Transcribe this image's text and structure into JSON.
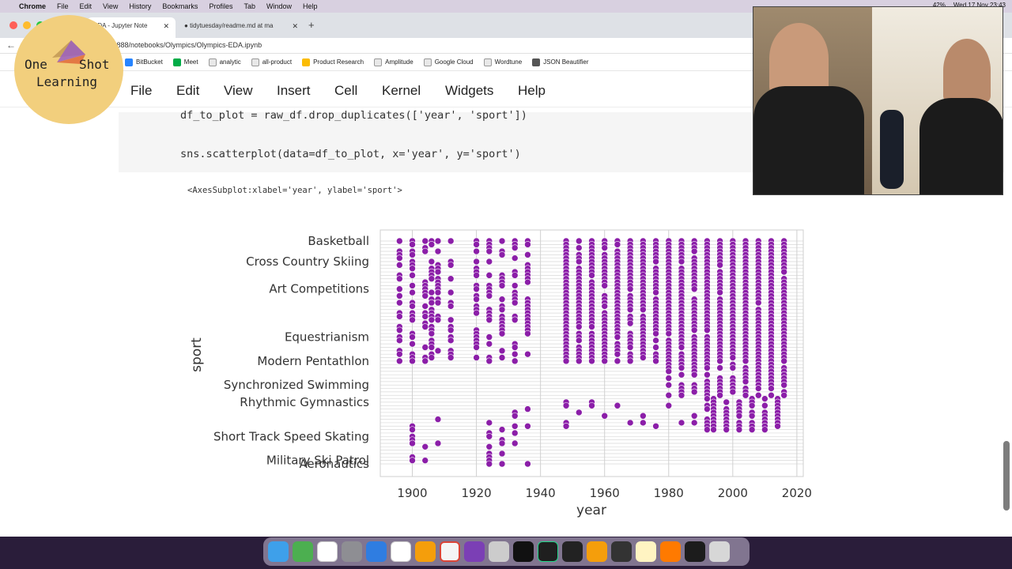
{
  "menubar": {
    "app": "Chrome",
    "items": [
      "File",
      "Edit",
      "View",
      "History",
      "Bookmarks",
      "Profiles",
      "Tab",
      "Window",
      "Help"
    ],
    "battery": "42%",
    "clock": "Wed 17 Nov  23:43"
  },
  "tabs": [
    {
      "label": "EDA - Jupyter Note"
    },
    {
      "label": "tidytuesday/readme.md at ma"
    }
  ],
  "address": {
    "url": "...888/notebooks/Olympics/Olympics-EDA.ipynb"
  },
  "bookmarks": [
    "BitBucket",
    "Meet",
    "analytic",
    "all-product",
    "Product Research",
    "Amplitude",
    "Google Cloud",
    "Wordtune",
    "JSON Beautifier"
  ],
  "jupyter_menu": [
    "File",
    "Edit",
    "View",
    "Insert",
    "Cell",
    "Kernel",
    "Widgets",
    "Help"
  ],
  "logo": {
    "line1a": "One",
    "line1b": "Shot",
    "line2": "Learning"
  },
  "code": {
    "line1": "df_to_plot = raw_df.drop_duplicates(['year', 'sport'])",
    "line2": "sns.scatterplot(data=df_to_plot, x='year', y='sport')"
  },
  "output_text": "<AxesSubplot:xlabel='year', ylabel='sport'>",
  "chart_data": {
    "type": "scatter",
    "title": "",
    "xlabel": "year",
    "ylabel": "sport",
    "xlim": [
      1890,
      2022
    ],
    "xticks": [
      1900,
      1920,
      1940,
      1960,
      1980,
      2000,
      2020
    ],
    "grid": true,
    "color": "#8b1ea8",
    "visible_ytick_labels": [
      "Basketball",
      "Cross Country Skiing",
      "Art Competitions",
      "Equestrianism",
      "Modern Pentathlon",
      "Synchronized Swimming",
      "Rhythmic Gymnastics",
      "Short Track Speed Skating",
      "Military Ski Patrol",
      "Aeronautics"
    ],
    "summer_years": [
      1896,
      1900,
      1904,
      1906,
      1908,
      1912,
      1920,
      1924,
      1928,
      1932,
      1936,
      1948,
      1952,
      1956,
      1960,
      1964,
      1968,
      1972,
      1976,
      1980,
      1984,
      1988,
      1992,
      1996,
      2000,
      2004,
      2008,
      2012,
      2016
    ],
    "winter_years": [
      1924,
      1928,
      1932,
      1936,
      1948,
      1952,
      1956,
      1960,
      1964,
      1968,
      1972,
      1976,
      1980,
      1984,
      1988,
      1992,
      1994,
      1998,
      2002,
      2006,
      2010,
      2014
    ]
  }
}
